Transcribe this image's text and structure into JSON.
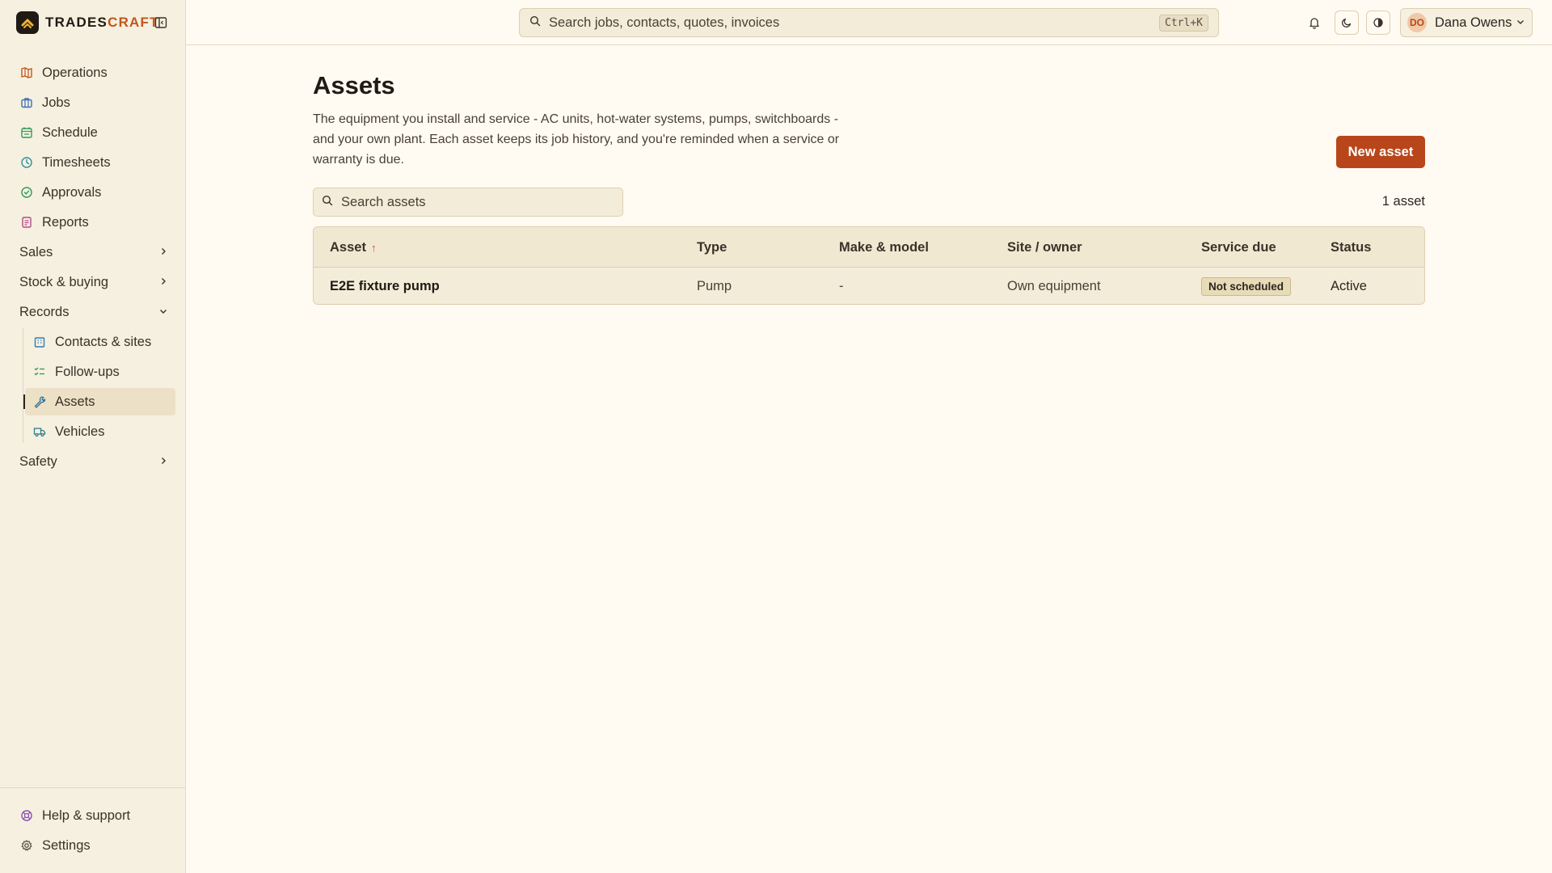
{
  "brand": {
    "name_main": "TRADES",
    "name_accent": "CRAFT"
  },
  "search": {
    "placeholder": "Search jobs, contacts, quotes, invoices",
    "shortcut": "Ctrl+K"
  },
  "user": {
    "initials": "DO",
    "name": "Dana Owens"
  },
  "sidebar": {
    "items": [
      {
        "label": "Operations",
        "icon": "map-icon",
        "color": "#c2561b"
      },
      {
        "label": "Jobs",
        "icon": "briefcase-icon",
        "color": "#3b6fb6"
      },
      {
        "label": "Schedule",
        "icon": "calendar-icon",
        "color": "#2f9a5a"
      },
      {
        "label": "Timesheets",
        "icon": "clock-icon",
        "color": "#2f8f9a"
      },
      {
        "label": "Approvals",
        "icon": "check-circle-icon",
        "color": "#2f9a5a"
      },
      {
        "label": "Reports",
        "icon": "report-icon",
        "color": "#b4488a"
      }
    ],
    "groups": {
      "sales": "Sales",
      "stock": "Stock & buying",
      "records": "Records",
      "safety": "Safety"
    },
    "records_items": [
      {
        "label": "Contacts & sites",
        "icon": "building-icon"
      },
      {
        "label": "Follow-ups",
        "icon": "checklist-icon"
      },
      {
        "label": "Assets",
        "icon": "wrench-icon"
      },
      {
        "label": "Vehicles",
        "icon": "truck-icon"
      }
    ],
    "bottom": {
      "help": "Help & support",
      "settings": "Settings"
    }
  },
  "page": {
    "title": "Assets",
    "description": "The equipment you install and service - AC units, hot-water systems, pumps, switchboards - and your own plant. Each asset keeps its job history, and you're reminded when a service or warranty is due.",
    "new_button": "New asset",
    "search_placeholder": "Search assets",
    "count": "1 asset"
  },
  "table": {
    "columns": {
      "asset": "Asset",
      "type": "Type",
      "make": "Make & model",
      "site": "Site / owner",
      "service": "Service due",
      "status": "Status"
    },
    "sort_indicator": "↑",
    "rows": [
      {
        "asset": "E2E fixture pump",
        "type": "Pump",
        "make": "-",
        "site": "Own equipment",
        "service": "Not scheduled",
        "status": "Active"
      }
    ]
  }
}
